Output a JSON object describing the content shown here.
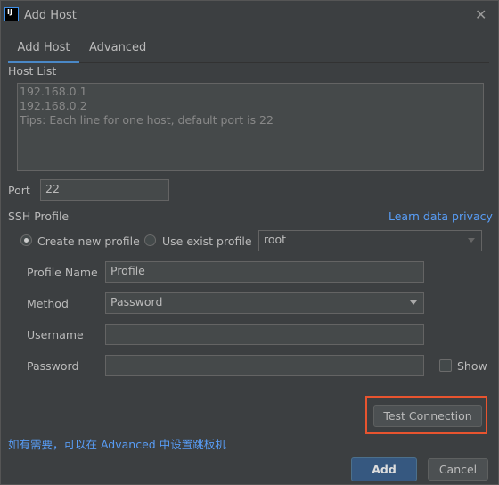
{
  "window": {
    "title": "Add Host",
    "logo_text": "IJ"
  },
  "tabs": [
    {
      "label": "Add Host",
      "active": true
    },
    {
      "label": "Advanced",
      "active": false
    }
  ],
  "host_list": {
    "label": "Host List",
    "lines": [
      "192.168.0.1",
      "192.168.0.2",
      "Tips: Each line for one host, default port is 22"
    ]
  },
  "port": {
    "label": "Port",
    "value": "22"
  },
  "ssh_profile": {
    "label": "SSH Profile",
    "privacy_link": "Learn data privacy",
    "create_new": "Create new profile",
    "use_exist": "Use exist profile",
    "selected": "create_new",
    "exist_value": "root"
  },
  "form": {
    "profile_name_label": "Profile Name",
    "profile_name_value": "Profile",
    "method_label": "Method",
    "method_value": "Password",
    "username_label": "Username",
    "username_value": "",
    "password_label": "Password",
    "password_value": "",
    "show_label": "Show",
    "show_checked": false
  },
  "buttons": {
    "test": "Test Connection",
    "add": "Add",
    "cancel": "Cancel"
  },
  "hint": "如有需要，可以在 Advanced 中设置跳板机",
  "colors": {
    "background": "#3c3f41",
    "accent": "#4a88c7",
    "link": "#589df6",
    "highlight_box": "#e8542f"
  }
}
